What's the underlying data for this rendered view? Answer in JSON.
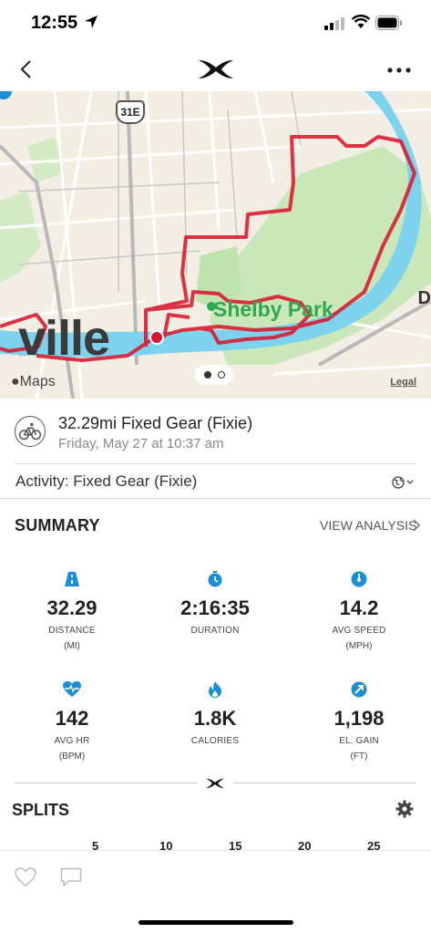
{
  "status_bar": {
    "time": "12:55"
  },
  "map": {
    "city_label": "ville",
    "park_label": "Shelby Park",
    "highway": "31E",
    "edge_letter": "D",
    "brand": "Maps",
    "legal": "Legal"
  },
  "workout": {
    "title": "32.29mi Fixed Gear (Fixie)",
    "date": "Friday, May 27 at 10:37 am",
    "activity_label": "Activity: ",
    "activity_value": "Fixed Gear (Fixie)"
  },
  "summary": {
    "title": "SUMMARY",
    "view_analysis": "VIEW ANALYSIS",
    "stats": [
      {
        "icon": "road-icon",
        "value": "32.29",
        "label": "DISTANCE",
        "unit": "(MI)"
      },
      {
        "icon": "stopwatch-icon",
        "value": "2:16:35",
        "label": "DURATION",
        "unit": ""
      },
      {
        "icon": "speedometer-icon",
        "value": "14.2",
        "label": "AVG SPEED",
        "unit": "(MPH)"
      },
      {
        "icon": "heart-rate-icon",
        "value": "142",
        "label": "AVG HR",
        "unit": "(BPM)"
      },
      {
        "icon": "flame-icon",
        "value": "1.8K",
        "label": "CALORIES",
        "unit": ""
      },
      {
        "icon": "elevation-arrow-icon",
        "value": "1,198",
        "label": "EL. GAIN",
        "unit": "(FT)"
      }
    ]
  },
  "splits": {
    "title": "SPLITS",
    "axis": [
      "5",
      "10",
      "15",
      "20",
      "25"
    ]
  },
  "colors": {
    "accent": "#1a8fd6",
    "route": "#d9182e",
    "park": "#2fa84f",
    "river": "#5ec8e8"
  }
}
